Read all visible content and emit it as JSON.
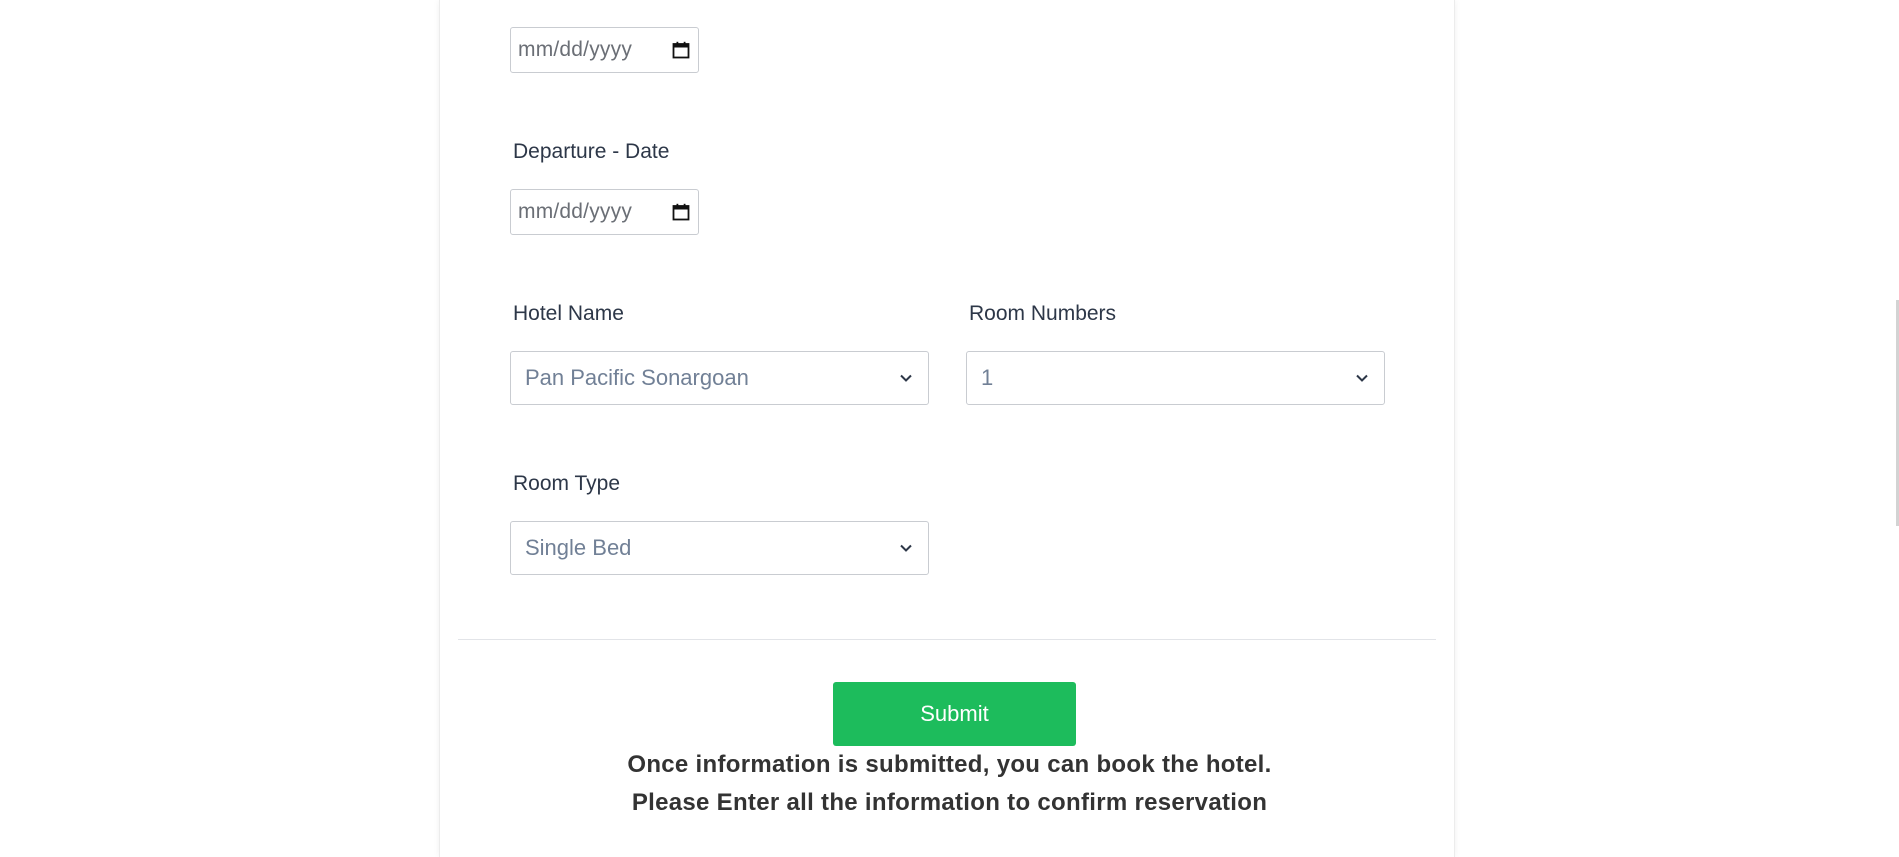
{
  "arrival": {
    "date_placeholder": "mm/dd/yyyy"
  },
  "departure": {
    "label": "Departure - Date",
    "date_placeholder": "mm/dd/yyyy"
  },
  "hotel": {
    "label": "Hotel Name",
    "selected": "Pan Pacific Sonargoan"
  },
  "rooms": {
    "label": "Room Numbers",
    "selected": "1"
  },
  "room_type": {
    "label": "Room Type",
    "selected": "Single Bed"
  },
  "form": {
    "submit_label": "Submit"
  },
  "notes": {
    "line1": "Once information is submitted, you can book the hotel.",
    "line2": "Please Enter all the information to confirm reservation"
  },
  "colors": {
    "submit_bg": "#1dbc5c",
    "border": "#c9ccd1",
    "placeholder": "#718096"
  }
}
